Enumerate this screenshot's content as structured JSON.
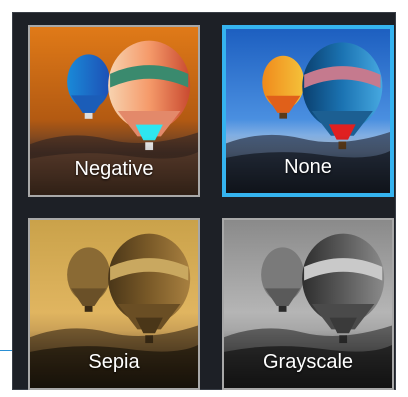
{
  "filters": [
    {
      "id": "negative",
      "label": "Negative",
      "selected": false
    },
    {
      "id": "none",
      "label": "None",
      "selected": true
    },
    {
      "id": "sepia",
      "label": "Sepia",
      "selected": false
    },
    {
      "id": "grayscale",
      "label": "Grayscale",
      "selected": false
    }
  ],
  "colors": {
    "panel_bg": "#1d2026",
    "selected_border": "#35b3ef",
    "tile_border": "#a8a8a8"
  }
}
